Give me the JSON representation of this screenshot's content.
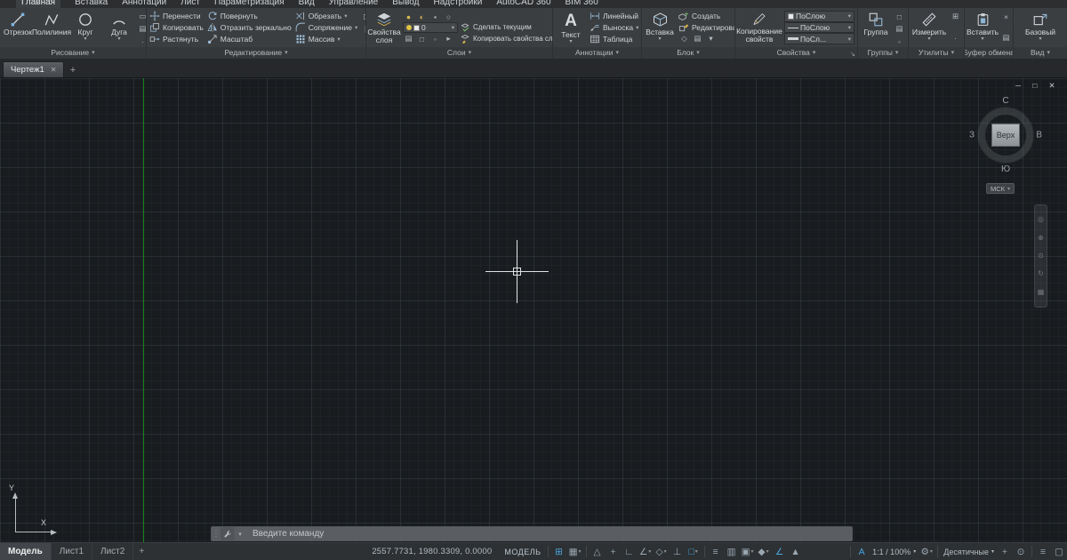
{
  "icons": {
    "caret_down": "▾",
    "close": "✕",
    "minimize": "─",
    "restore": "□",
    "plus": "+",
    "dialog_launcher": "↘",
    "grip": "⋮",
    "grid": "⊞",
    "snap": "▦",
    "infer": "△",
    "dyn_input": "+",
    "ortho": "∟",
    "polar": "∠",
    "iso": "◇",
    "otrack": "⊥",
    "osnap": "□",
    "lineweight": "≡",
    "transparency": "▥",
    "cycling": "▣",
    "osnap3d": "◆",
    "ucs_toggle": "∠",
    "annot_monitor": "▲",
    "annot_vis": "A",
    "gear": "⚙",
    "isolate": "⊙",
    "clean": "▢",
    "wheel": "◎",
    "pan": "⊕",
    "zoom": "⊙",
    "orbit": "↻",
    "motion": "▦"
  },
  "ribbon": {
    "tabs": [
      "Главная",
      "Вставка",
      "Аннотации",
      "Лист",
      "Параметризация",
      "Вид",
      "Управление",
      "Вывод",
      "Надстройки",
      "AutoCAD 360",
      "BIM 360"
    ],
    "draw": {
      "label": "Рисование",
      "line": "Отрезок",
      "polyline": "Полилиния",
      "circle": "Круг",
      "arc": "Дуга"
    },
    "modify": {
      "label": "Редактирование",
      "move": "Перенести",
      "copy": "Копировать",
      "stretch": "Растянуть",
      "rotate": "Повернуть",
      "mirror": "Отразить зеркально",
      "scale": "Масштаб",
      "trim": "Обрезать",
      "fillet": "Сопряжение",
      "array": "Массив"
    },
    "layers": {
      "label": "Слои",
      "properties": "Свойства слоя",
      "current_layer": "0",
      "make_current": "Сделать текущим",
      "match": "Копировать свойства слоя"
    },
    "annotation": {
      "label": "Аннотации",
      "text": "Текст",
      "dimension": "Линейный",
      "leader": "Выноска",
      "table": "Таблица"
    },
    "block": {
      "label": "Блок",
      "insert": "Вставка",
      "create": "Создать",
      "edit": "Редактировать"
    },
    "properties": {
      "label": "Свойства",
      "matchprops": "Копирование свойств",
      "color": "ПоСлою",
      "linetype": "ПоСлою",
      "lineweight": "ПоСл..."
    },
    "groups": {
      "label": "Группы",
      "group": "Группа"
    },
    "utilities": {
      "label": "Утилиты",
      "measure": "Измерить"
    },
    "clipboard": {
      "label": "Буфер обмена",
      "paste": "Вставить"
    },
    "view": {
      "label": "Вид",
      "base": "Базовый"
    }
  },
  "file_tabs": {
    "drawing1": "Чертеж1"
  },
  "viewport": {
    "viewcube": {
      "n": "С",
      "s": "Ю",
      "w": "З",
      "e": "В",
      "face": "Верх",
      "wcs": "МСК"
    },
    "ucs": {
      "x": "X",
      "y": "Y"
    }
  },
  "command_line": {
    "placeholder": "Введите команду"
  },
  "status_bar": {
    "layout_model": "Модель",
    "layout1": "Лист1",
    "layout2": "Лист2",
    "coordinates": "2557.7731, 1980.3309, 0.0000",
    "space": "МОДЕЛЬ",
    "scale": "1:1 / 100%",
    "units": "Десятичные"
  }
}
